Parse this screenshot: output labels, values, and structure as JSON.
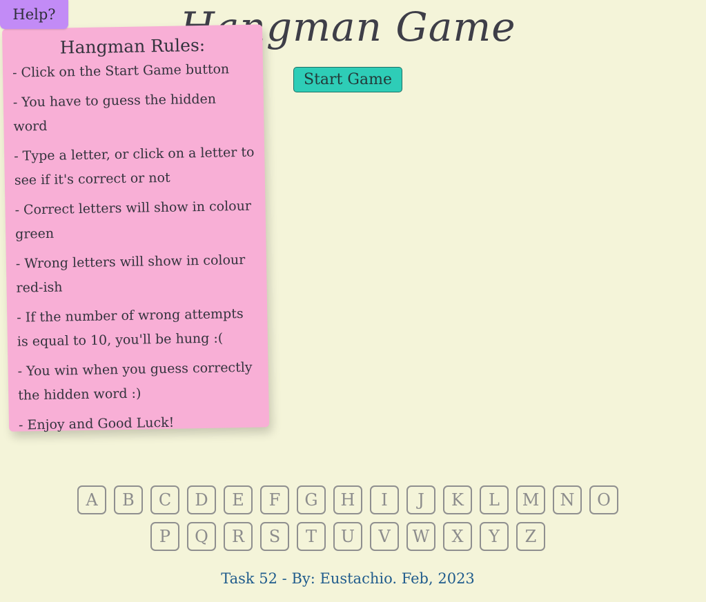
{
  "help": {
    "label": "Help?"
  },
  "title": "Hangman Game",
  "start": {
    "label": "Start Game"
  },
  "rules": {
    "title": "Hangman Rules:",
    "items": [
      "- Click on the Start Game button",
      "- You have to guess the hidden word",
      "- Type a letter, or click on a letter to see if it's correct or not",
      "- Correct letters will show in colour green",
      "- Wrong letters will show in colour red-ish",
      "- If the number of wrong attempts is equal to 10, you'll be hung :(",
      "- You win when you guess correctly the hidden word :)",
      "- Enjoy and Good Luck!"
    ]
  },
  "letters": {
    "row1": [
      "A",
      "B",
      "C",
      "D",
      "E",
      "F",
      "G",
      "H",
      "I",
      "J",
      "K",
      "L",
      "M",
      "N",
      "O"
    ],
    "row2": [
      "P",
      "Q",
      "R",
      "S",
      "T",
      "U",
      "V",
      "W",
      "X",
      "Y",
      "Z"
    ]
  },
  "footer": "Task 52 - By: Eustachio. Feb, 2023",
  "colors": {
    "background": "#f4f4d9",
    "help": "#c28bf6",
    "rules_card": "#f8afd6",
    "start_button": "#2ecdb7",
    "letter_border": "#8f8f8f",
    "footer_text": "#1f5b8c"
  }
}
